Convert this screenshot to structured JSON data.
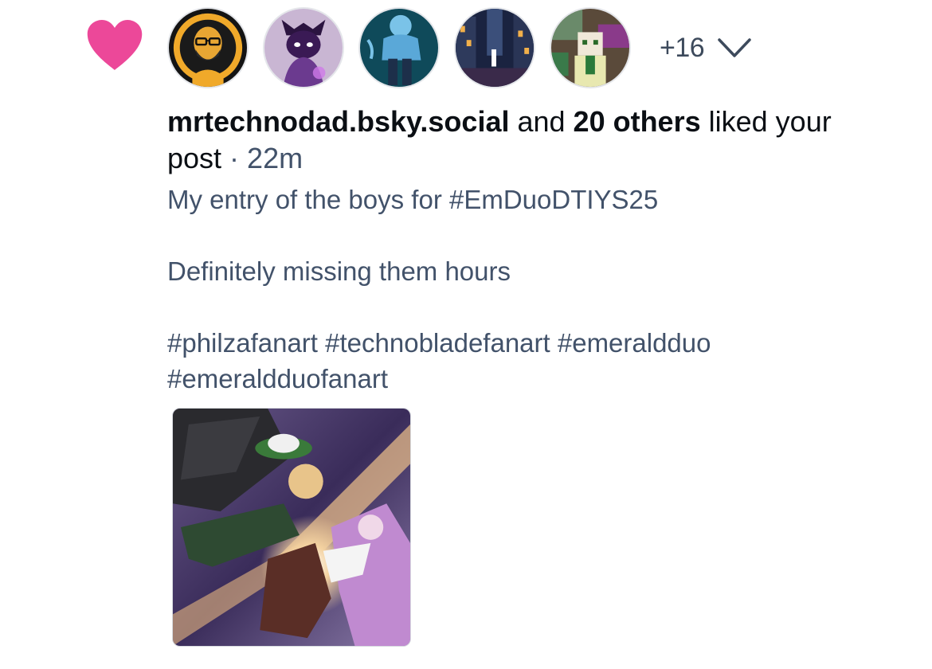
{
  "notification": {
    "icon": "heart-icon",
    "heart_color": "#ec4899",
    "avatars": [
      {
        "name": "avatar-1",
        "desc": "bald man with glasses and beard on yellow-black background"
      },
      {
        "name": "avatar-2",
        "desc": "purple character with glowing eyes"
      },
      {
        "name": "avatar-3",
        "desc": "blue character on teal background"
      },
      {
        "name": "avatar-4",
        "desc": "night city street"
      },
      {
        "name": "avatar-5",
        "desc": "minecraft-style character"
      }
    ],
    "more_count": "+16",
    "expand_icon": "chevron-down-icon",
    "liker": "mrtechnodad.bsky.social",
    "and_text": " and ",
    "others_text": "20 others",
    "liked_text": " liked your post",
    "separator": " · ",
    "time": "22m"
  },
  "post": {
    "line1": "My entry of the boys for #EmDuoDTIYS25",
    "line2": "Definitely missing them hours",
    "line3": "#philzafanart #technobladefanart #emeraldduo",
    "line4": "#emeraldduofanart",
    "image": "fan-art-thumbnail"
  },
  "colors": {
    "text_primary": "#0b0f14",
    "text_secondary": "#42526a",
    "heart": "#ec4899"
  }
}
